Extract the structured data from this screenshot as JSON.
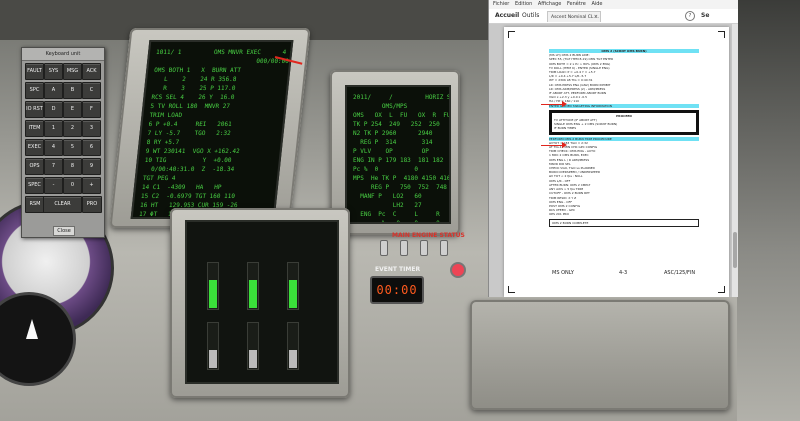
{
  "keyboard_unit": {
    "title": "Keyboard unit",
    "keys": [
      [
        "FAULT",
        "SYS",
        "MSG",
        "ACK"
      ],
      [
        "SPC",
        "A",
        "B",
        "C"
      ],
      [
        "IO RST",
        "D",
        "E",
        "F"
      ],
      [
        "ITEM",
        "1",
        "2",
        "3"
      ],
      [
        "EXEC",
        "4",
        "5",
        "6"
      ],
      [
        "OPS",
        "7",
        "8",
        "9"
      ],
      [
        "SPEC",
        "-",
        "0",
        "+"
      ]
    ],
    "bottom_keys": [
      "RSM",
      "CLEAR",
      "PRO"
    ],
    "close_label": "Close"
  },
  "pdf_viewer": {
    "menu": [
      "Fichier",
      "Edition",
      "Affichage",
      "Fenêtre",
      "Aide"
    ],
    "toolbar": {
      "home_label": "Accueil",
      "tools_label": "Outils",
      "tab_label": "Ascent Nominal CL ...",
      "tab_close": "×",
      "help_icon_label": "?",
      "signin_label": "Se connecter"
    },
    "footer": {
      "left": "MS ONLY",
      "center": "4-3",
      "right": "ASC/125/FIN"
    },
    "doc_lines": {
      "heading": "OMS 2 (SCRNT OMS BURN)",
      "block_highlight": "ENTER GUIDED TARGETING INFORMATION",
      "boxed_title": "PROCEED",
      "boxed_line1": "TV ATTITUDE (IF ABORT ATT)",
      "boxed_line2": "SINGLE OMS ENG + 2 OMS (SCRNT BURN)",
      "boxed_line3": "IF BURN TIMES",
      "second_highlight": "PERFORM OMS 2 BURN TRIM PROCEDURE",
      "lower_boxed": "OMS 2 BURN COMPLETE"
    },
    "page_lines": [
      "(MS LH) OMS 2 BURN LINE:",
      "SPEC 55, (TGT ITEM 8-19) OMS TGT ENTER",
      "OMS BOTH = 2 x Pc > 80%  (OMS 2 ENG)",
      "TV ROLL (ITEM 9) - ENTER (SINGLE ENG)",
      "TRIM LOAD: P = +0.4    Y = +5.7",
      "            L/R = +0.4 +5.7  L/R -5.7",
      "WT = 230K LB   TIG = 0:40:31",
      "LR: OMS PRESS ENA (GN2) BURN INHIBIT",
      "LR: OMS ARM/PRESS (2) - ARM/PRESS",
      "IF ABORT ATT, PERFORM ABORT BURN",
      "VGO x +2.3   y +0.0   z -0.5",
      "HA / HP  = 160 / 110",
      "ΔVTOT = 183   TGO = 2:32",
      "AT TIG-15 MIN CHK GPC CONFIG",
      "TRIM CHECK: OMS ENG - AUTO",
      "1 MIN: 2 OMS BURN, EXEC",
      "OMS ENG  L / R  ARM/PRESS",
      "MNVR DIR SEL",
      "CHECK VGO, TGO vs PLANNED",
      "BURN OVERSPEED / UNDERSPEED",
      "ΔV TOT < 2 fps : NULL",
      "OMS L/R  - OFF",
      "AFTER BURN: OMS 2 CMPLT",
      "ANY AXIS  > 5 fps  TRIM",
      "CUTOFF - OMS 2 BURN RPT",
      "TRIM RESID: X  Y  Z",
      "OMS ENG - OFF",
      "POST OMS 2 CONFIG",
      "RCS XFEED - GPC",
      "OPS 201 PRO"
    ]
  },
  "cockpit": {
    "event_timer": "00:00",
    "placard_main_engine": "MAIN ENGINE STATUS",
    "placard_event_timer": "EVENT TIMER",
    "mfd1_lines": [
      "1011/ 1         OMS MNVR EXEC      4 000/00:40:31",
      "                            000/00:00:00",
      "OMS BOTH 1   X  BURN ATT",
      "   L    2    24 R 356.8",
      "   R    3    25 P 117.0",
      "RCS SEL 4    26 Y  16.0",
      "5 TV ROLL 180  MNVR 27",
      "TRIM LOAD",
      "6 P +0.4     REI   2061",
      "7 LY -5.7    TGO   2:32",
      "8 RY +5.7",
      "9 WT 230141  VGO X +162.42",
      "10 TIG          Y  +0.00",
      "  0/00:40:31.0  Z  -18.34",
      "TGT PEG 4",
      "14 C1  -4309   HA   HP",
      "15 C2  -0.6979 TGT 160 110",
      "16 HT   129.953 CUR 159 -26",
      "17 ΦT   178.210",
      "18 PRPLT   0.0  35 ABORT TGT",
      "GMBL",
      "  L   R",
      "P +0.4 +0.4",
      "Y -5.7 +5.7",
      "PRI 28  29",
      "SEC 30  31",
      "OFF 32  33",
      "GMBL CK 34"
    ],
    "mfd2_lines": [
      "2011/     /         HORIZ SIT",
      "        OMS/MPS         ",
      "OMS   OX  L  FU   OX  R  FU",
      "TK P 254  249   252  250",
      "N2 TK P 2960      2940",
      "  REG P  314       314",
      "P VLV    OP        OP",
      "ENG IN P 179 183  181 182",
      "Pc %  0          0",
      "MPS  He TK P  4180 4150 4160",
      "     REG P   750  752  748",
      "  MANF P   LO2   60",
      "           LH2   27",
      "  ENG  Pc  C     L     R",
      "        %   0    0     0",
      "  MPS TVC",
      "ERR 1 2 3",
      "ACT 1  0  0"
    ]
  }
}
